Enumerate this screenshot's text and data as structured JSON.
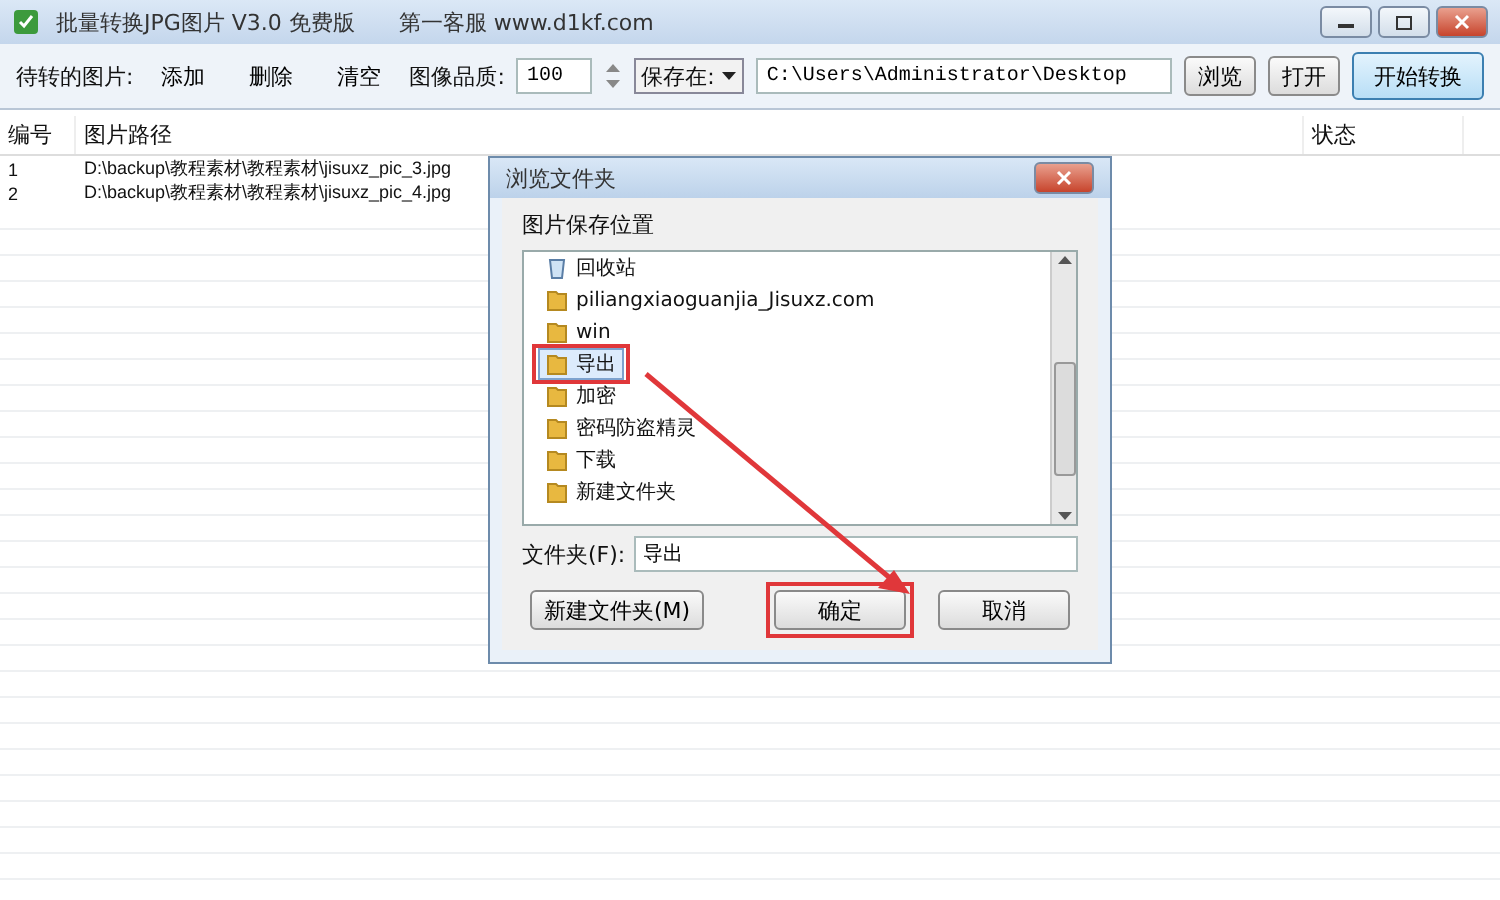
{
  "window": {
    "title": "批量转换JPG图片 V3.0 免费版",
    "service": "第一客服 www.d1kf.com"
  },
  "toolbar": {
    "label": "待转的图片:",
    "actions": [
      "添加",
      "删除",
      "清空"
    ],
    "quality_label": "图像品质:",
    "quality": "100",
    "save_mode": "保存在:",
    "save_path": "C:\\Users\\Administrator\\Desktop",
    "browse": "浏览",
    "open": "打开",
    "start": "开始转换"
  },
  "table": {
    "columns": [
      "编号",
      "图片路径",
      "状态"
    ],
    "rows": [
      {
        "index": "1",
        "path": "D:\\backup\\教程素材\\教程素材\\jisuxz_pic_3.jpg"
      },
      {
        "index": "2",
        "path": "D:\\backup\\教程素材\\教程素材\\jisuxz_pic_4.jpg"
      }
    ]
  },
  "dialog": {
    "title": "浏览文件夹",
    "prompt": "图片保存位置",
    "items": [
      {
        "label": "回收站",
        "kind": "recycle",
        "selected": false,
        "highlighted": false
      },
      {
        "label": "piliangxiaoguanjia_Jisuxz.com",
        "kind": "folder",
        "selected": false,
        "highlighted": false
      },
      {
        "label": "win",
        "kind": "folder",
        "selected": false,
        "highlighted": false
      },
      {
        "label": "导出",
        "kind": "folder",
        "selected": true,
        "highlighted": true
      },
      {
        "label": "加密",
        "kind": "folder",
        "selected": false,
        "highlighted": false
      },
      {
        "label": "密码防盗精灵",
        "kind": "folder",
        "selected": false,
        "highlighted": false
      },
      {
        "label": "下载",
        "kind": "folder",
        "selected": false,
        "highlighted": false
      },
      {
        "label": "新建文件夹",
        "kind": "folder",
        "selected": false,
        "highlighted": false
      }
    ],
    "folder_label": "文件夹(F):",
    "folder_value": "导出",
    "buttons": [
      {
        "label": "新建文件夹(M)",
        "highlighted": false
      },
      {
        "label": "确定",
        "highlighted": true
      },
      {
        "label": "取消",
        "highlighted": false
      }
    ]
  }
}
